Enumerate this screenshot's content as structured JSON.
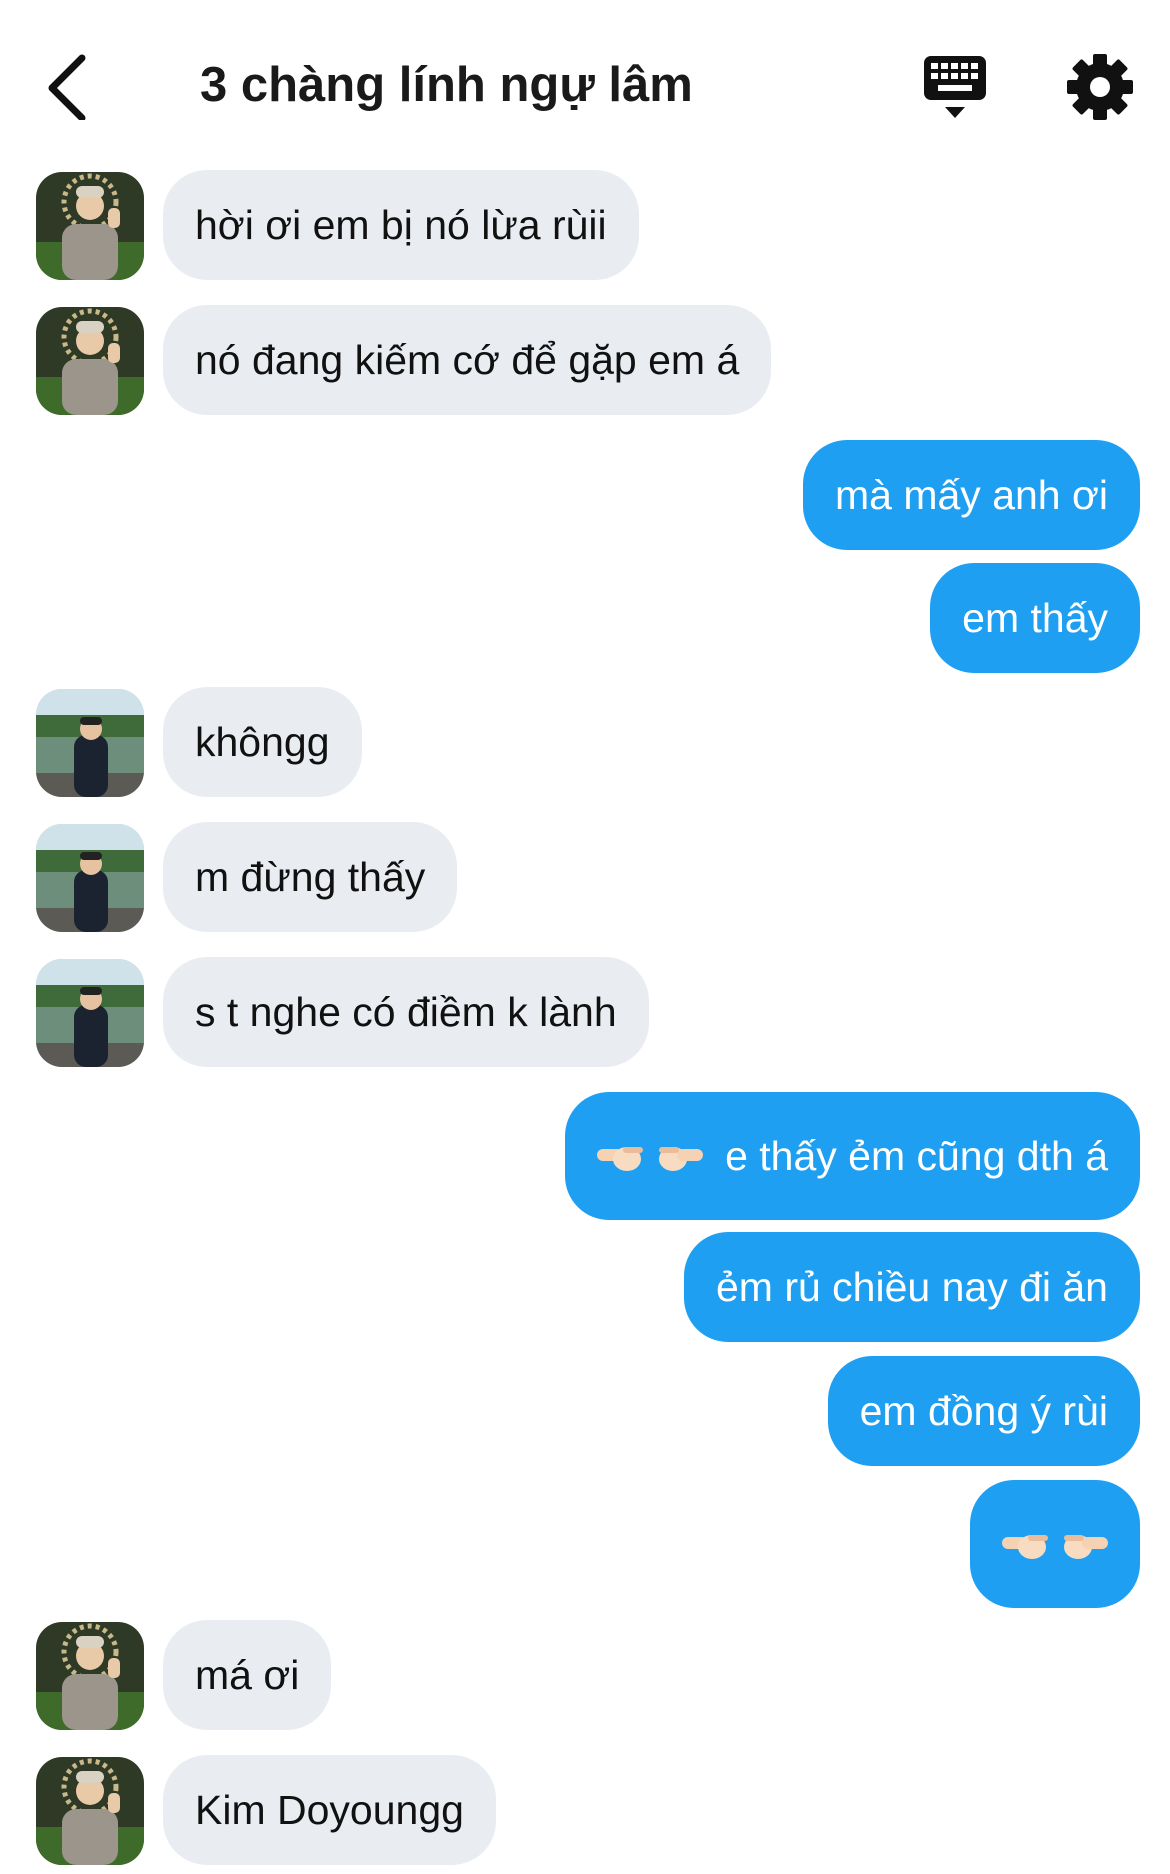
{
  "header": {
    "title": "3 chàng lính ngự lâm",
    "back_icon": "chevron-left-icon",
    "keyboard_icon": "keyboard-icon",
    "settings_icon": "gear-icon"
  },
  "colors": {
    "incoming_bubble": "#e9edf2",
    "outgoing_bubble": "#1e9ff1"
  },
  "messages": [
    {
      "sender": "them",
      "avatar": "avatar-a",
      "text": "hời ơi em bị nó lừa rùii"
    },
    {
      "sender": "them",
      "avatar": "avatar-a",
      "text": "nó đang kiếm cớ để gặp em á"
    },
    {
      "sender": "me",
      "text": "mà mấy anh ơi"
    },
    {
      "sender": "me",
      "text": "em thấy"
    },
    {
      "sender": "them",
      "avatar": "avatar-b",
      "text": "khôngg"
    },
    {
      "sender": "them",
      "avatar": "avatar-b",
      "text": "m đừng thấy"
    },
    {
      "sender": "them",
      "avatar": "avatar-b",
      "text": "s t nghe có điềm k lành"
    },
    {
      "sender": "me",
      "emoji": "pointing-hands",
      "text": "e thấy ẻm cũng dth á"
    },
    {
      "sender": "me",
      "text": "ẻm rủ chiều nay đi ăn"
    },
    {
      "sender": "me",
      "text": "em đồng ý rùi"
    },
    {
      "sender": "me",
      "emoji": "pointing-hands",
      "text": ""
    },
    {
      "sender": "them",
      "avatar": "avatar-a",
      "text": "má ơi"
    },
    {
      "sender": "them",
      "avatar": "avatar-a",
      "text": "Kim Doyoungg"
    }
  ]
}
